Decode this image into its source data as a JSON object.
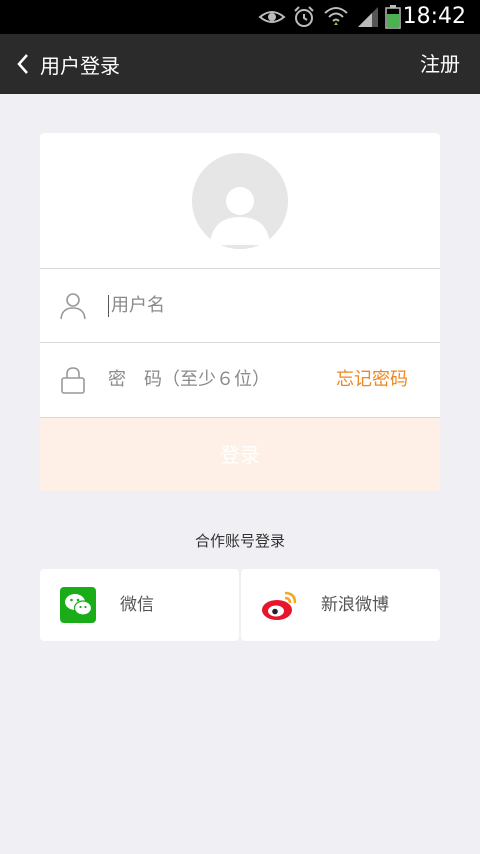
{
  "status_bar": {
    "time": "18:42",
    "icons": [
      "eye-icon",
      "alarm-icon",
      "wifi-icon",
      "signal-icon",
      "battery-icon"
    ]
  },
  "nav": {
    "title": "用户登录",
    "register_label": "注册"
  },
  "form": {
    "username_placeholder": "用户名",
    "password_placeholder": "密　码（至少６位）",
    "forgot_label": "忘记密码",
    "login_label": "登录"
  },
  "partners": {
    "heading": "合作账号登录",
    "items": [
      {
        "label": "微信",
        "icon": "wechat-icon"
      },
      {
        "label": "新浪微博",
        "icon": "weibo-icon"
      }
    ]
  },
  "colors": {
    "accent": "#f0861e",
    "login_button_bg": "#fef0e6",
    "nav_bg": "#2b2b2b",
    "page_bg": "#efeff4",
    "wechat_green": "#1aad19",
    "weibo_red": "#e6162d"
  }
}
